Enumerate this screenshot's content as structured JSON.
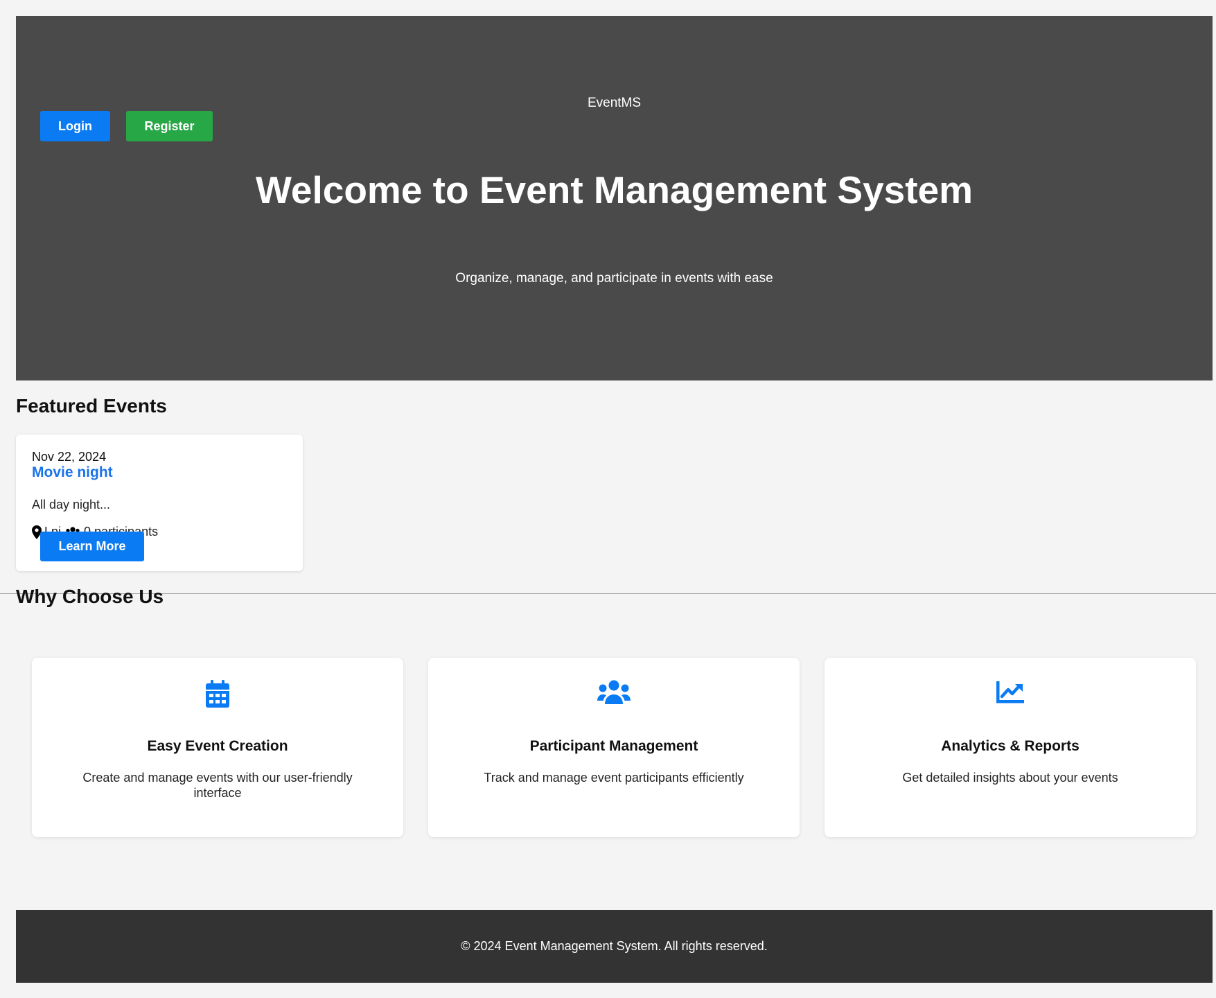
{
  "colors": {
    "hero_bg": "#4a4a4a",
    "primary": "#0a7bf3",
    "success": "#27a745",
    "event_title": "#1a73e8",
    "footer_bg": "#333333",
    "page_bg": "#f4f4f4"
  },
  "hero": {
    "brand": "EventMS",
    "login_label": "Login",
    "register_label": "Register",
    "title": "Welcome to Event Management System",
    "tagline": "Organize, manage, and participate in events with ease"
  },
  "featured": {
    "heading": "Featured Events",
    "events": [
      {
        "date": "Nov 22, 2024",
        "name": "Movie night",
        "description": "All day night...",
        "location": "Lpi",
        "participants": "0 participants",
        "button_label": "Learn More",
        "icons": [
          "map-pin-icon",
          "users-icon"
        ]
      }
    ]
  },
  "why": {
    "heading": "Why Choose Us",
    "features": [
      {
        "icon": "calendar-icon",
        "title": "Easy Event Creation",
        "description": "Create and manage events with our user-friendly interface"
      },
      {
        "icon": "users-icon",
        "title": "Participant Management",
        "description": "Track and manage event participants efficiently"
      },
      {
        "icon": "chart-line-icon",
        "title": "Analytics & Reports",
        "description": "Get detailed insights about your events"
      }
    ]
  },
  "footer": {
    "text": "© 2024 Event Management System. All rights reserved."
  }
}
